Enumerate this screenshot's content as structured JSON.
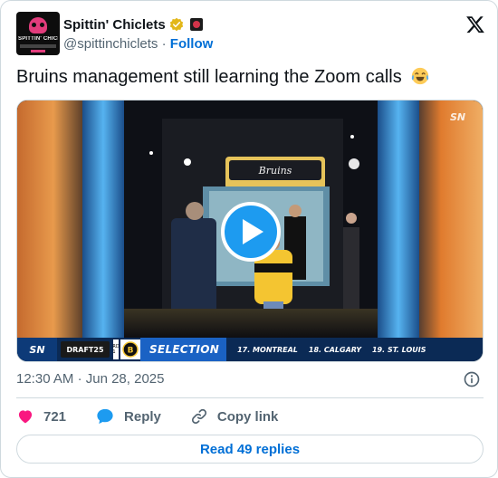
{
  "author": {
    "display_name": "Spittin' Chiclets",
    "handle": "@spittinchiclets",
    "separator": "·",
    "follow_label": "Follow",
    "avatar_text": "SPITTIN' CHICLETS"
  },
  "tweet": {
    "text": "Bruins management still learning the Zoom calls"
  },
  "video": {
    "network_logo": "SN",
    "broadcast": {
      "network": "SN",
      "event": "DRAFT25",
      "round": "RD 1",
      "label": "SELECTION",
      "picks": [
        "17. MONTREAL",
        "18. CALGARY",
        "19. ST. LOUIS"
      ]
    },
    "screen_logo": "Bruins"
  },
  "meta": {
    "time": "12:30 AM",
    "separator": "·",
    "date": "Jun 28, 2025"
  },
  "actions": {
    "likes": "721",
    "reply_label": "Reply",
    "copy_label": "Copy link"
  },
  "replies_button": "Read 49 replies",
  "colors": {
    "accent": "#1d9bf0",
    "link": "#006fd6",
    "like": "#f91880",
    "secondary_text": "#536471",
    "border": "#cfd9de"
  }
}
